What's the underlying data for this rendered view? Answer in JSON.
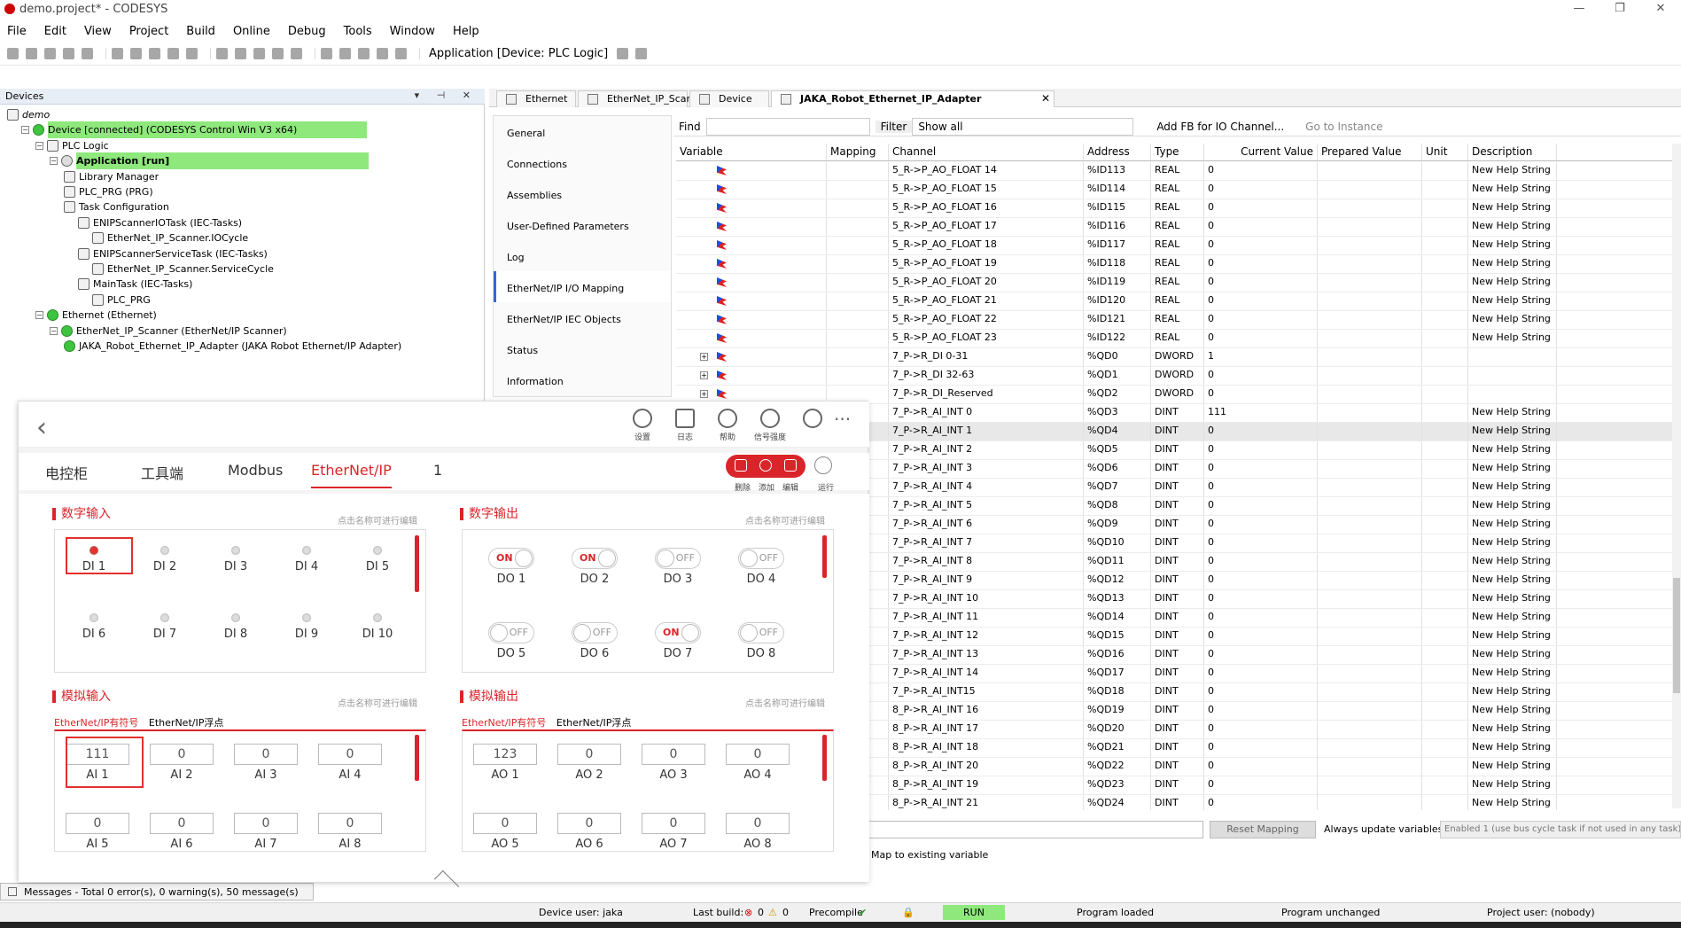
{
  "window": {
    "title": "demo.project* - CODESYS"
  },
  "menu": [
    "File",
    "Edit",
    "View",
    "Project",
    "Build",
    "Online",
    "Debug",
    "Tools",
    "Window",
    "Help"
  ],
  "toolbar": {
    "application_selector": "Application [Device: PLC Logic]"
  },
  "devices_panel": {
    "title": "Devices",
    "tree": [
      {
        "label": "demo",
        "level": 0
      },
      {
        "label": "Device [connected] (CODESYS Control Win V3 x64)",
        "level": 1,
        "highlight": true
      },
      {
        "label": "PLC Logic",
        "level": 2
      },
      {
        "label": "Application [run]",
        "level": 3,
        "highlight": true
      },
      {
        "label": "Library Manager",
        "level": 4
      },
      {
        "label": "PLC_PRG (PRG)",
        "level": 4
      },
      {
        "label": "Task Configuration",
        "level": 4
      },
      {
        "label": "ENIPScannerIOTask (IEC-Tasks)",
        "level": 5
      },
      {
        "label": "EtherNet_IP_Scanner.IOCycle",
        "level": 6
      },
      {
        "label": "ENIPScannerServiceTask (IEC-Tasks)",
        "level": 5
      },
      {
        "label": "EtherNet_IP_Scanner.ServiceCycle",
        "level": 6
      },
      {
        "label": "MainTask (IEC-Tasks)",
        "level": 5
      },
      {
        "label": "PLC_PRG",
        "level": 6
      },
      {
        "label": "Ethernet (Ethernet)",
        "level": 2
      },
      {
        "label": "EtherNet_IP_Scanner (EtherNet/IP Scanner)",
        "level": 3
      },
      {
        "label": "JAKA_Robot_Ethernet_IP_Adapter (JAKA Robot Ethernet/IP Adapter)",
        "level": 4
      }
    ]
  },
  "editor_tabs": [
    {
      "label": "Ethernet",
      "active": false
    },
    {
      "label": "EtherNet_IP_Scanner",
      "active": false
    },
    {
      "label": "Device",
      "active": false
    },
    {
      "label": "JAKA_Robot_Ethernet_IP_Adapter",
      "active": true
    }
  ],
  "left_nav": [
    "General",
    "Connections",
    "Assemblies",
    "User-Defined Parameters",
    "Log",
    "EtherNet/IP I/O Mapping",
    "EtherNet/IP IEC Objects",
    "Status",
    "Information"
  ],
  "left_nav_active": "EtherNet/IP I/O Mapping",
  "find_bar": {
    "find": "Find",
    "filter": "Filter",
    "filter_value": "Show all",
    "add_fb": "Add FB for IO Channel...",
    "goto": "Go to Instance"
  },
  "grid": {
    "columns": [
      "Variable",
      "Mapping",
      "Channel",
      "Address",
      "Type",
      "Current Value",
      "Prepared Value",
      "Unit",
      "Description"
    ],
    "rows": [
      {
        "channel": "5_R->P_AO_FLOAT 14",
        "address": "%ID113",
        "type": "REAL",
        "value": "0",
        "desc": "New Help String"
      },
      {
        "channel": "5_R->P_AO_FLOAT 15",
        "address": "%ID114",
        "type": "REAL",
        "value": "0",
        "desc": "New Help String"
      },
      {
        "channel": "5_R->P_AO_FLOAT 16",
        "address": "%ID115",
        "type": "REAL",
        "value": "0",
        "desc": "New Help String"
      },
      {
        "channel": "5_R->P_AO_FLOAT 17",
        "address": "%ID116",
        "type": "REAL",
        "value": "0",
        "desc": "New Help String"
      },
      {
        "channel": "5_R->P_AO_FLOAT 18",
        "address": "%ID117",
        "type": "REAL",
        "value": "0",
        "desc": "New Help String"
      },
      {
        "channel": "5_R->P_AO_FLOAT 19",
        "address": "%ID118",
        "type": "REAL",
        "value": "0",
        "desc": "New Help String"
      },
      {
        "channel": "5_R->P_AO_FLOAT 20",
        "address": "%ID119",
        "type": "REAL",
        "value": "0",
        "desc": "New Help String"
      },
      {
        "channel": "5_R->P_AO_FLOAT 21",
        "address": "%ID120",
        "type": "REAL",
        "value": "0",
        "desc": "New Help String"
      },
      {
        "channel": "5_R->P_AO_FLOAT 22",
        "address": "%ID121",
        "type": "REAL",
        "value": "0",
        "desc": "New Help String"
      },
      {
        "channel": "5_R->P_AO_FLOAT 23",
        "address": "%ID122",
        "type": "REAL",
        "value": "0",
        "desc": "New Help String"
      },
      {
        "channel": "7_P->R_DI 0-31",
        "address": "%QD0",
        "type": "DWORD",
        "value": "1",
        "desc": "",
        "exp": true
      },
      {
        "channel": "7_P->R_DI 32-63",
        "address": "%QD1",
        "type": "DWORD",
        "value": "0",
        "desc": "",
        "exp": true
      },
      {
        "channel": "7_P->R_DI_Reserved",
        "address": "%QD2",
        "type": "DWORD",
        "value": "0",
        "desc": "",
        "exp": true
      },
      {
        "channel": "7_P->R_AI_INT 0",
        "address": "%QD3",
        "type": "DINT",
        "value": "111",
        "desc": "New Help String"
      },
      {
        "channel": "7_P->R_AI_INT 1",
        "address": "%QD4",
        "type": "DINT",
        "value": "0",
        "desc": "New Help String",
        "sel": true
      },
      {
        "channel": "7_P->R_AI_INT 2",
        "address": "%QD5",
        "type": "DINT",
        "value": "0",
        "desc": "New Help String"
      },
      {
        "channel": "7_P->R_AI_INT 3",
        "address": "%QD6",
        "type": "DINT",
        "value": "0",
        "desc": "New Help String"
      },
      {
        "channel": "7_P->R_AI_INT 4",
        "address": "%QD7",
        "type": "DINT",
        "value": "0",
        "desc": "New Help String"
      },
      {
        "channel": "7_P->R_AI_INT 5",
        "address": "%QD8",
        "type": "DINT",
        "value": "0",
        "desc": "New Help String"
      },
      {
        "channel": "7_P->R_AI_INT 6",
        "address": "%QD9",
        "type": "DINT",
        "value": "0",
        "desc": "New Help String"
      },
      {
        "channel": "7_P->R_AI_INT 7",
        "address": "%QD10",
        "type": "DINT",
        "value": "0",
        "desc": "New Help String"
      },
      {
        "channel": "7_P->R_AI_INT 8",
        "address": "%QD11",
        "type": "DINT",
        "value": "0",
        "desc": "New Help String"
      },
      {
        "channel": "7_P->R_AI_INT 9",
        "address": "%QD12",
        "type": "DINT",
        "value": "0",
        "desc": "New Help String"
      },
      {
        "channel": "7_P->R_AI_INT 10",
        "address": "%QD13",
        "type": "DINT",
        "value": "0",
        "desc": "New Help String"
      },
      {
        "channel": "7_P->R_AI_INT 11",
        "address": "%QD14",
        "type": "DINT",
        "value": "0",
        "desc": "New Help String"
      },
      {
        "channel": "7_P->R_AI_INT 12",
        "address": "%QD15",
        "type": "DINT",
        "value": "0",
        "desc": "New Help String"
      },
      {
        "channel": "7_P->R_AI_INT 13",
        "address": "%QD16",
        "type": "DINT",
        "value": "0",
        "desc": "New Help String"
      },
      {
        "channel": "7_P->R_AI_INT 14",
        "address": "%QD17",
        "type": "DINT",
        "value": "0",
        "desc": "New Help String"
      },
      {
        "channel": "7_P->R_AI_INT15",
        "address": "%QD18",
        "type": "DINT",
        "value": "0",
        "desc": "New Help String"
      },
      {
        "channel": "8_P->R_AI_INT 16",
        "address": "%QD19",
        "type": "DINT",
        "value": "0",
        "desc": "New Help String"
      },
      {
        "channel": "8_P->R_AI_INT 17",
        "address": "%QD20",
        "type": "DINT",
        "value": "0",
        "desc": "New Help String"
      },
      {
        "channel": "8_P->R_AI_INT 18",
        "address": "%QD21",
        "type": "DINT",
        "value": "0",
        "desc": "New Help String"
      },
      {
        "channel": "8_P->R_AI_INT 20",
        "address": "%QD22",
        "type": "DINT",
        "value": "0",
        "desc": "New Help String"
      },
      {
        "channel": "8_P->R_AI_INT 19",
        "address": "%QD23",
        "type": "DINT",
        "value": "0",
        "desc": "New Help String"
      },
      {
        "channel": "8_P->R_AI_INT 21",
        "address": "%QD24",
        "type": "DINT",
        "value": "0",
        "desc": "New Help String"
      }
    ]
  },
  "mapping_footer": {
    "reset": "Reset Mapping",
    "always": "Always update variables",
    "enabled": "Enabled 1 (use bus cycle task if not used in any task)",
    "map_existing": "Map to existing variable"
  },
  "messages": "Messages - Total 0 error(s), 0 warning(s), 50 message(s)",
  "status": {
    "user": "Device user: jaka",
    "last_build": "Last build:",
    "err": "0",
    "warn": "0",
    "precompile": "Precompile",
    "run": "RUN",
    "loaded": "Program loaded",
    "unchanged": "Program unchanged",
    "project_user": "Project user: (nobody)"
  },
  "jaka": {
    "icons": [
      {
        "name": "settings",
        "label": "设置"
      },
      {
        "name": "log",
        "label": "日志"
      },
      {
        "name": "help",
        "label": "帮助"
      },
      {
        "name": "signal",
        "label": "信号强度"
      },
      {
        "name": "robot",
        "label": ""
      }
    ],
    "tabs": [
      "电控柜",
      "工具端",
      "Modbus",
      "EtherNet/IP",
      "1"
    ],
    "active_tab": "EtherNet/IP",
    "ctrl_labels": [
      "删除",
      "添加",
      "编辑",
      "运行"
    ],
    "di_title": "数字输入",
    "do_title": "数字输出",
    "ai_title": "模拟输入",
    "ao_title": "模拟输出",
    "hint": "点击名称可进行编辑",
    "subtab_int": "EtherNet/IP有符号",
    "subtab_float": "EtherNet/IP浮点",
    "di": [
      {
        "label": "DI 1",
        "on": true
      },
      {
        "label": "DI 2",
        "on": false
      },
      {
        "label": "DI 3",
        "on": false
      },
      {
        "label": "DI 4",
        "on": false
      },
      {
        "label": "DI 5",
        "on": false
      },
      {
        "label": "DI 6",
        "on": false
      },
      {
        "label": "DI 7",
        "on": false
      },
      {
        "label": "DI 8",
        "on": false
      },
      {
        "label": "DI 9",
        "on": false
      },
      {
        "label": "DI 10",
        "on": false
      }
    ],
    "do": [
      {
        "label": "DO 1",
        "state": "ON"
      },
      {
        "label": "DO 2",
        "state": "ON"
      },
      {
        "label": "DO 3",
        "state": "OFF"
      },
      {
        "label": "DO 4",
        "state": "OFF"
      },
      {
        "label": "DO 5",
        "state": "OFF"
      },
      {
        "label": "DO 6",
        "state": "OFF"
      },
      {
        "label": "DO 7",
        "state": "ON"
      },
      {
        "label": "DO 8",
        "state": "OFF"
      }
    ],
    "ai": [
      {
        "label": "AI 1",
        "value": "111"
      },
      {
        "label": "AI 2",
        "value": "0"
      },
      {
        "label": "AI 3",
        "value": "0"
      },
      {
        "label": "AI 4",
        "value": "0"
      },
      {
        "label": "AI 5",
        "value": "0"
      },
      {
        "label": "AI 6",
        "value": "0"
      },
      {
        "label": "AI 7",
        "value": "0"
      },
      {
        "label": "AI 8",
        "value": "0"
      }
    ],
    "ao": [
      {
        "label": "AO 1",
        "value": "123"
      },
      {
        "label": "AO 2",
        "value": "0"
      },
      {
        "label": "AO 3",
        "value": "0"
      },
      {
        "label": "AO 4",
        "value": "0"
      },
      {
        "label": "AO 5",
        "value": "0"
      },
      {
        "label": "AO 6",
        "value": "0"
      },
      {
        "label": "AO 7",
        "value": "0"
      },
      {
        "label": "AO 8",
        "value": "0"
      }
    ]
  }
}
